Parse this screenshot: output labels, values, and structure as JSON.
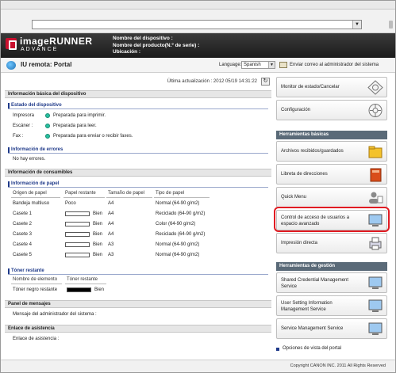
{
  "header": {
    "brand_main": "imageRUNNER",
    "brand_sub": "ADVANCE",
    "device_name_label": "Nombre del dispositivo :",
    "product_name_label": "Nombre del producto(N.º de serie) :",
    "location_label": "Ubicación :"
  },
  "portal_bar": {
    "title": "IU remota: Portal",
    "language_label": "Language:",
    "language_value": "Spanish",
    "mail_link": "Enviar correo al administrador del sistema"
  },
  "main": {
    "last_update_label": "Última actualización : 2012 05/19 14:31:22",
    "basic_info_title": "Información básica del dispositivo",
    "device_status_title": "Estado del dispositivo",
    "status_rows": [
      {
        "label": "Impresora",
        "value": "Preparada para imprimir."
      },
      {
        "label": "Escáner :",
        "value": "Preparada para leer."
      },
      {
        "label": "Fax :",
        "value": "Preparada para enviar o recibir faxes."
      }
    ],
    "error_info_title": "Información de errores",
    "no_errors": "No hay errores.",
    "consumables_title": "Información de consumibles",
    "paper_info_title": "Información de papel",
    "paper_columns": [
      "Origen de papel",
      "Papel restante",
      "Tamaño de papel",
      "Tipo de papel"
    ],
    "paper_rows": [
      {
        "source": "Bandeja multiuso",
        "remaining": "Poco",
        "size": "A4",
        "type": "Normal (64-90 g/m2)"
      },
      {
        "source": "Casete 1",
        "remaining": "Bien",
        "size": "A4",
        "type": "Reciclado (64-90 g/m2)"
      },
      {
        "source": "Casete 2",
        "remaining": "Bien",
        "size": "A4",
        "type": "Color (64-90 g/m2)"
      },
      {
        "source": "Casete 3",
        "remaining": "Bien",
        "size": "A4",
        "type": "Reciclado (64-90 g/m2)"
      },
      {
        "source": "Casete 4",
        "remaining": "Bien",
        "size": "A3",
        "type": "Normal (64-90 g/m2)"
      },
      {
        "source": "Casete 5",
        "remaining": "Bien",
        "size": "A3",
        "type": "Normal (64-90 g/m2)"
      }
    ],
    "toner_title": "Tóner restante",
    "toner_columns": [
      "Nombre de elemento",
      "Tóner restante"
    ],
    "toner_row": {
      "name": "Tóner negro restante",
      "value": "Bien"
    },
    "messages_title": "Panel de mensajes",
    "admin_message": "Mensaje del administrador del sistema :",
    "support_title": "Enlace de asistencia",
    "support_link": "Enlace de asistencia :"
  },
  "right": {
    "monitor_label": "Monitor de estado/Cancelar",
    "config_label": "Configuración",
    "basic_tools_title": "Herramientas básicas",
    "received_files_label": "Archivos recibidos/guardados",
    "address_book_label": "Libreta de direcciones",
    "quick_menu_label": "Quick Menu",
    "access_control_label_1": "Control de acceso de usuarios a",
    "access_control_label_2": "espacio avanzado",
    "direct_print_label": "Impresión directa",
    "mgmt_tools_title": "Herramientas de gestión",
    "scms_label_1": "Shared Credential Management",
    "scms_label_2": "Service",
    "uism_label_1": "User Setting Information",
    "uism_label_2": "Management Service",
    "sms_label": "Service Management Service",
    "portal_options": "Opciones de vista del portal"
  },
  "footer": {
    "copyright": "Copyright CANON INC. 2011 All Rights Reserved"
  }
}
